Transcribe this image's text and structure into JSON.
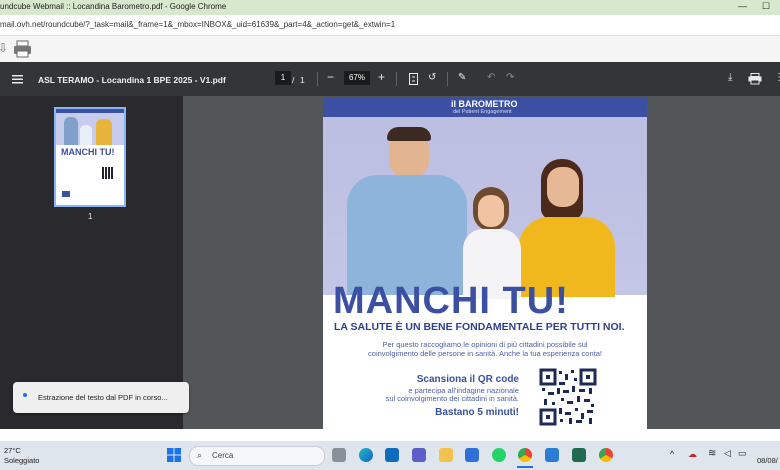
{
  "window": {
    "title": "undcube Webmail :: Locandina Barometro.pdf - Google Chrome",
    "url": "mail.ovh.net/roundcube/?_task=mail&_frame=1&_mbox=INBOX&_uid=61639&_part=4&_action=get&_extwin=1"
  },
  "pdf_toolbar": {
    "filename": "ASL TERAMO - Locandina 1 BPE 2025 - V1.pdf",
    "current_page": "1",
    "separator": "/",
    "total_pages": "1",
    "zoom": "67%",
    "minus": "−",
    "plus": "+"
  },
  "sidebar": {
    "thumb_label": "1"
  },
  "poster": {
    "brand_top": "il BAROMETRO",
    "brand_sub": "del Patient Engagement",
    "headline": "MANCHI TU!",
    "subheadline": "LA SALUTE È UN BENE FONDAMENTALE PER TUTTI NOI.",
    "body_line1": "Per questo raccogliamo le opinioni di più cittadini possibile sul",
    "body_line2": "coinvolgimento delle persone in sanità. Anche la tua esperienza conta!",
    "qr_title": "Scansiona il QR code",
    "qr_line1": "e partecipa all'indagine nazionale",
    "qr_line2": "sul coinvolgimento dei cittadini in sanità.",
    "qr_cta": "Bastano 5 minuti!"
  },
  "toast": {
    "text": "Estrazione del testo dal PDF in corso..."
  },
  "taskbar": {
    "temp": "27°C",
    "weather": "Soleggiato",
    "search_placeholder": "Cerca",
    "date": "08/08/"
  },
  "colors": {
    "poster_blue": "#3b4fa3",
    "pdf_toolbar": "#323639",
    "accent": "#8ab4f8"
  }
}
